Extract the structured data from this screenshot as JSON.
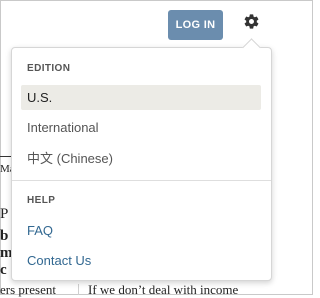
{
  "header": {
    "login_label": "LOG IN",
    "settings_icon": "gear-icon"
  },
  "background": {
    "fragment_1": "Ma",
    "fragment_2": "P",
    "fragment_3": "b",
    "fragment_4": "m",
    "fragment_5": "c",
    "fragment_6": "c",
    "fragment_bottom_left": "ers present",
    "fragment_bottom_right": "If we don’t deal with income"
  },
  "menu": {
    "edition_title": "EDITION",
    "edition_items": [
      {
        "label": "U.S.",
        "selected": true
      },
      {
        "label": "International",
        "selected": false
      },
      {
        "label": "中文 (Chinese)",
        "selected": false
      }
    ],
    "help_title": "HELP",
    "help_items": [
      {
        "label": "FAQ"
      },
      {
        "label": "Contact Us"
      }
    ]
  },
  "colors": {
    "login_button": "#6b8dae",
    "link": "#326891",
    "selected_bg": "#ecebe6"
  }
}
